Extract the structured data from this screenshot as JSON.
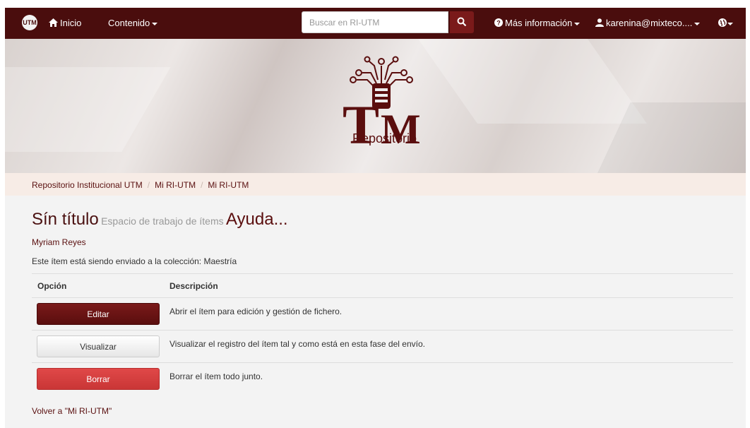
{
  "navbar": {
    "logo_text": "UTM",
    "home_label": "Inicio",
    "content_label": "Contenido",
    "search_placeholder": "Buscar en RI-UTM",
    "more_info_label": "Más información",
    "user_label": "karenina@mixteco....",
    "colors": {
      "bar": "#4a0d0d",
      "search_button": "#7a1a1a"
    }
  },
  "banner": {
    "brand": "Repositorio"
  },
  "breadcrumb": [
    "Repositorio Institucional UTM",
    "Mi RI-UTM",
    "Mi RI-UTM"
  ],
  "page": {
    "title": "Sín título",
    "subtitle": "Espacio de trabajo de ítems",
    "help": "Ayuda...",
    "author": "Myriam Reyes",
    "collection_note": "Este ítem está siendo enviado a la colección: Maestría"
  },
  "table": {
    "headers": [
      "Opción",
      "Descripción"
    ],
    "rows": [
      {
        "button": "Editar",
        "description": "Abrir el ítem para edición y gestión de fichero."
      },
      {
        "button": "Visualizar",
        "description": "Visualizar el registro del ítem tal y como está en esta fase del envío."
      },
      {
        "button": "Borrar",
        "description": "Borrar el ítem todo junto."
      }
    ]
  },
  "back_link": "Volver a \"Mi RI-UTM\""
}
